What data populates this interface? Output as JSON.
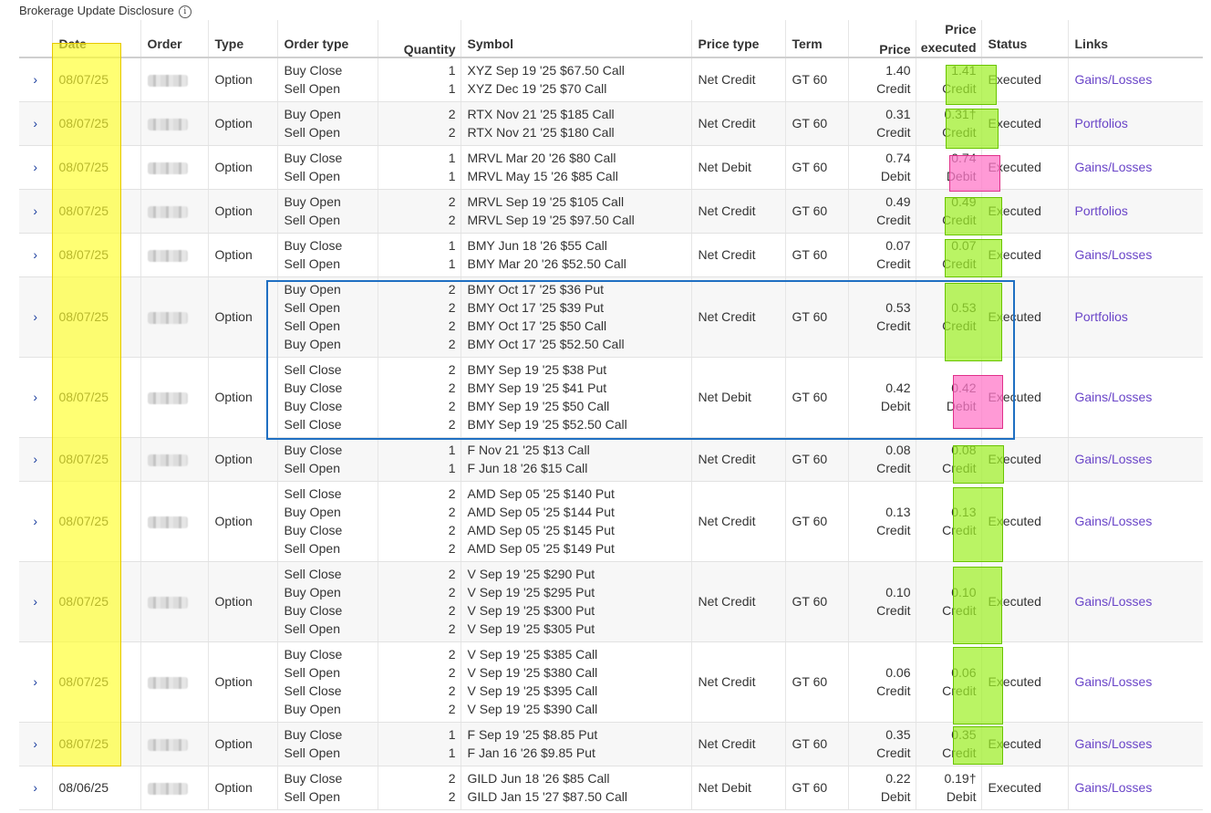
{
  "page_title": "Brokerage Update Disclosure",
  "info_icon_glyph": "i",
  "expand_glyph": "›",
  "columns": {
    "date": "Date",
    "order": "Order",
    "type": "Type",
    "order_type": "Order type",
    "quantity": "Quantity",
    "symbol": "Symbol",
    "price_type": "Price type",
    "term": "Term",
    "price": "Price",
    "price_executed": "Price executed",
    "status": "Status",
    "links": "Links"
  },
  "rows": [
    {
      "date": "08/07/25",
      "type": "Option",
      "order_types": [
        "Buy Close",
        "Sell Open"
      ],
      "quantities": [
        "1",
        "1"
      ],
      "symbols": [
        "XYZ Sep 19 '25 $67.50 Call",
        "XYZ Dec 19 '25 $70 Call"
      ],
      "price_type": "Net Credit",
      "term": "GT 60",
      "price": "1.40",
      "price_kind": "Credit",
      "exec_price": "1.41",
      "exec_kind": "Credit",
      "status": "Executed",
      "link": "Gains/Losses"
    },
    {
      "date": "08/07/25",
      "type": "Option",
      "order_types": [
        "Buy Open",
        "Sell Open"
      ],
      "quantities": [
        "2",
        "2"
      ],
      "symbols": [
        "RTX Nov 21 '25 $185 Call",
        "RTX Nov 21 '25 $180 Call"
      ],
      "price_type": "Net Credit",
      "term": "GT 60",
      "price": "0.31",
      "price_kind": "Credit",
      "exec_price": "0.31†",
      "exec_kind": "Credit",
      "status": "Executed",
      "link": "Portfolios"
    },
    {
      "date": "08/07/25",
      "type": "Option",
      "order_types": [
        "Buy Close",
        "Sell Open"
      ],
      "quantities": [
        "1",
        "1"
      ],
      "symbols": [
        "MRVL Mar 20 '26 $80 Call",
        "MRVL May 15 '26 $85 Call"
      ],
      "price_type": "Net Debit",
      "term": "GT 60",
      "price": "0.74",
      "price_kind": "Debit",
      "exec_price": "0.74",
      "exec_kind": "Debit",
      "status": "Executed",
      "link": "Gains/Losses"
    },
    {
      "date": "08/07/25",
      "type": "Option",
      "order_types": [
        "Buy Open",
        "Sell Open"
      ],
      "quantities": [
        "2",
        "2"
      ],
      "symbols": [
        "MRVL Sep 19 '25 $105 Call",
        "MRVL Sep 19 '25 $97.50 Call"
      ],
      "price_type": "Net Credit",
      "term": "GT 60",
      "price": "0.49",
      "price_kind": "Credit",
      "exec_price": "0.49",
      "exec_kind": "Credit",
      "status": "Executed",
      "link": "Portfolios"
    },
    {
      "date": "08/07/25",
      "type": "Option",
      "order_types": [
        "Buy Close",
        "Sell Open"
      ],
      "quantities": [
        "1",
        "1"
      ],
      "symbols": [
        "BMY Jun 18 '26 $55 Call",
        "BMY Mar 20 '26 $52.50 Call"
      ],
      "price_type": "Net Credit",
      "term": "GT 60",
      "price": "0.07",
      "price_kind": "Credit",
      "exec_price": "0.07",
      "exec_kind": "Credit",
      "status": "Executed",
      "link": "Gains/Losses"
    },
    {
      "date": "08/07/25",
      "type": "Option",
      "order_types": [
        "Buy Open",
        "Sell Open",
        "Sell Open",
        "Buy Open"
      ],
      "quantities": [
        "2",
        "2",
        "2",
        "2"
      ],
      "symbols": [
        "BMY Oct 17 '25 $36 Put",
        "BMY Oct 17 '25 $39 Put",
        "BMY Oct 17 '25 $50 Call",
        "BMY Oct 17 '25 $52.50 Call"
      ],
      "price_type": "Net Credit",
      "term": "GT 60",
      "price": "0.53",
      "price_kind": "Credit",
      "exec_price": "0.53",
      "exec_kind": "Credit",
      "status": "Executed",
      "link": "Portfolios"
    },
    {
      "date": "08/07/25",
      "type": "Option",
      "order_types": [
        "Sell Close",
        "Buy Close",
        "Buy Close",
        "Sell Close"
      ],
      "quantities": [
        "2",
        "2",
        "2",
        "2"
      ],
      "symbols": [
        "BMY Sep 19 '25 $38 Put",
        "BMY Sep 19 '25 $41 Put",
        "BMY Sep 19 '25 $50 Call",
        "BMY Sep 19 '25 $52.50 Call"
      ],
      "price_type": "Net Debit",
      "term": "GT 60",
      "price": "0.42",
      "price_kind": "Debit",
      "exec_price": "0.42",
      "exec_kind": "Debit",
      "status": "Executed",
      "link": "Gains/Losses"
    },
    {
      "date": "08/07/25",
      "type": "Option",
      "order_types": [
        "Buy Close",
        "Sell Open"
      ],
      "quantities": [
        "1",
        "1"
      ],
      "symbols": [
        "F Nov 21 '25 $13 Call",
        "F Jun 18 '26 $15 Call"
      ],
      "price_type": "Net Credit",
      "term": "GT 60",
      "price": "0.08",
      "price_kind": "Credit",
      "exec_price": "0.08",
      "exec_kind": "Credit",
      "status": "Executed",
      "link": "Gains/Losses"
    },
    {
      "date": "08/07/25",
      "type": "Option",
      "order_types": [
        "Sell Close",
        "Buy Open",
        "Buy Close",
        "Sell Open"
      ],
      "quantities": [
        "2",
        "2",
        "2",
        "2"
      ],
      "symbols": [
        "AMD Sep 05 '25 $140 Put",
        "AMD Sep 05 '25 $144 Put",
        "AMD Sep 05 '25 $145 Put",
        "AMD Sep 05 '25 $149 Put"
      ],
      "price_type": "Net Credit",
      "term": "GT 60",
      "price": "0.13",
      "price_kind": "Credit",
      "exec_price": "0.13",
      "exec_kind": "Credit",
      "status": "Executed",
      "link": "Gains/Losses"
    },
    {
      "date": "08/07/25",
      "type": "Option",
      "order_types": [
        "Sell Close",
        "Buy Open",
        "Buy Close",
        "Sell Open"
      ],
      "quantities": [
        "2",
        "2",
        "2",
        "2"
      ],
      "symbols": [
        "V Sep 19 '25 $290 Put",
        "V Sep 19 '25 $295 Put",
        "V Sep 19 '25 $300 Put",
        "V Sep 19 '25 $305 Put"
      ],
      "price_type": "Net Credit",
      "term": "GT 60",
      "price": "0.10",
      "price_kind": "Credit",
      "exec_price": "0.10",
      "exec_kind": "Credit",
      "status": "Executed",
      "link": "Gains/Losses"
    },
    {
      "date": "08/07/25",
      "type": "Option",
      "order_types": [
        "Buy Close",
        "Sell Open",
        "Sell Close",
        "Buy Open"
      ],
      "quantities": [
        "2",
        "2",
        "2",
        "2"
      ],
      "symbols": [
        "V Sep 19 '25 $385 Call",
        "V Sep 19 '25 $380 Call",
        "V Sep 19 '25 $395 Call",
        "V Sep 19 '25 $390 Call"
      ],
      "price_type": "Net Credit",
      "term": "GT 60",
      "price": "0.06",
      "price_kind": "Credit",
      "exec_price": "0.06",
      "exec_kind": "Credit",
      "status": "Executed",
      "link": "Gains/Losses"
    },
    {
      "date": "08/07/25",
      "type": "Option",
      "order_types": [
        "Buy Close",
        "Sell Open"
      ],
      "quantities": [
        "1",
        "1"
      ],
      "symbols": [
        "F Sep 19 '25 $8.85 Put",
        "F Jan 16 '26 $9.85 Put"
      ],
      "price_type": "Net Credit",
      "term": "GT 60",
      "price": "0.35",
      "price_kind": "Credit",
      "exec_price": "0.35",
      "exec_kind": "Credit",
      "status": "Executed",
      "link": "Gains/Losses"
    },
    {
      "date": "08/06/25",
      "type": "Option",
      "order_types": [
        "Buy Close",
        "Sell Open"
      ],
      "quantities": [
        "2",
        "2"
      ],
      "symbols": [
        "GILD Jun 18 '26 $85 Call",
        "GILD Jan 15 '27 $87.50 Call"
      ],
      "price_type": "Net Debit",
      "term": "GT 60",
      "price": "0.22",
      "price_kind": "Debit",
      "exec_price": "0.19†",
      "exec_kind": "Debit",
      "status": "Executed",
      "link": "Gains/Losses"
    }
  ],
  "highlights": {
    "date_color": "#ffff28",
    "credit_color": "#a0f028",
    "debit_color": "#ff78c8",
    "box_color": "#1f6fc2"
  }
}
